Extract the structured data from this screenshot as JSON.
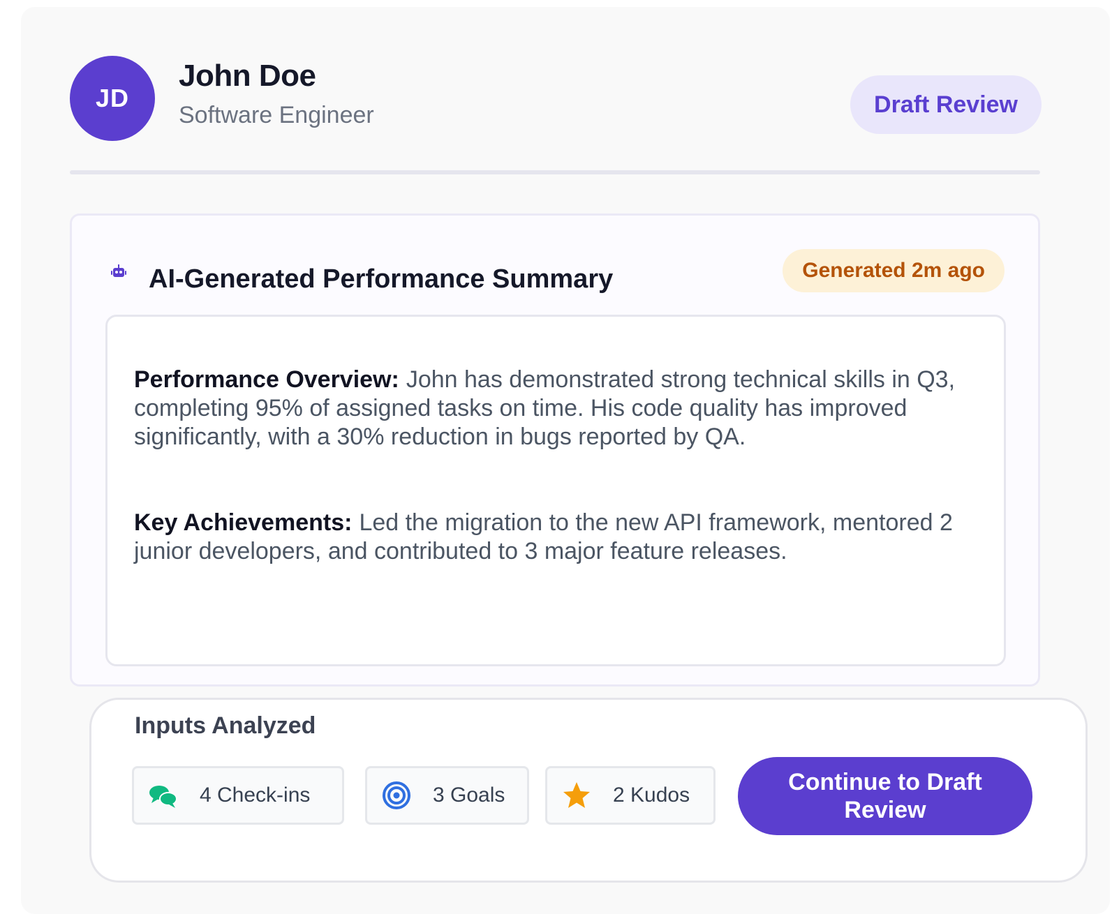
{
  "profile": {
    "initials": "JD",
    "name": "John Doe",
    "role": "Software Engineer",
    "status_label": "Draft Review"
  },
  "summary": {
    "icon": "robot-icon",
    "title": "AI-Generated Performance Summary",
    "generated_label": "Generated 2m ago",
    "paragraphs": [
      {
        "lead": "Performance Overview:",
        "text": "John has demonstrated strong technical skills in Q3, completing 95% of assigned tasks on time. His code quality has improved significantly, with a 30% reduction in bugs reported by QA."
      },
      {
        "lead": "Key Achievements:",
        "text": "Led the migration to the new API framework, mentored 2 junior developers, and contributed to 3 major feature releases."
      }
    ]
  },
  "inputs": {
    "title": "Inputs Analyzed",
    "chips": [
      {
        "icon": "chat-bubbles-icon",
        "label": "4 Check-ins"
      },
      {
        "icon": "target-icon",
        "label": "3 Goals"
      },
      {
        "icon": "star-icon",
        "label": "2 Kudos"
      }
    ],
    "continue_label": "Continue to Draft Review"
  },
  "colors": {
    "primary": "#5b3ecf",
    "badge_bg": "#fdf1d7",
    "badge_text": "#b45309",
    "pill_bg": "#e9e6fb",
    "checkin_icon": "#10b981",
    "goal_icon": "#2f6fe0",
    "kudos_icon": "#f59e0b"
  }
}
